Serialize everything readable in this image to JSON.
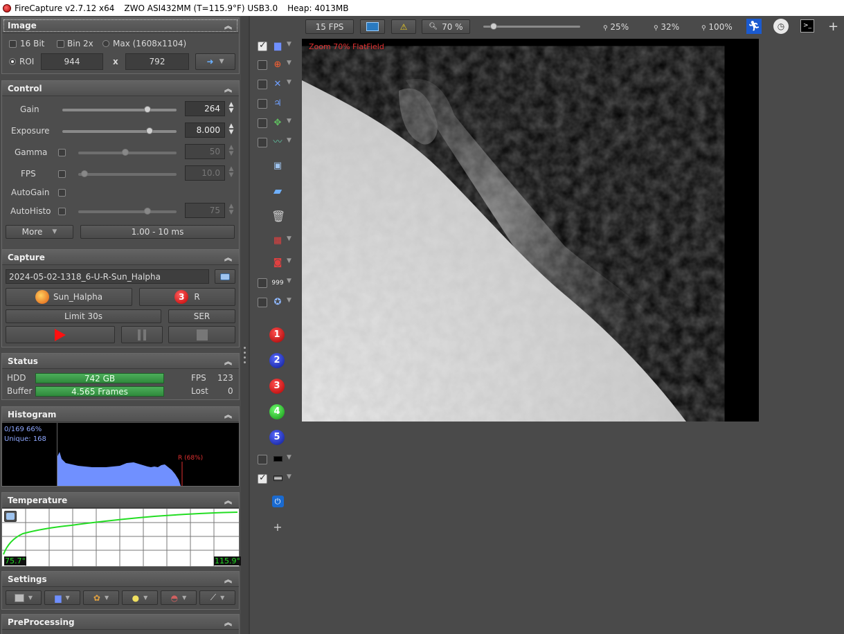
{
  "titlebar": {
    "app": "FireCapture v2.7.12 x64",
    "camera": "ZWO ASI432MM (T=115.9°F) USB3.0",
    "heap": "Heap: 4013MB"
  },
  "image_panel": {
    "title": "Image",
    "opt_16bit": "16 Bit",
    "opt_bin": "Bin 2x",
    "opt_max": "Max (1608x1104)",
    "opt_roi": "ROI",
    "roi_w": "944",
    "roi_x": "x",
    "roi_h": "792"
  },
  "control_panel": {
    "title": "Control",
    "gain_label": "Gain",
    "gain_value": "264",
    "exposure_label": "Exposure",
    "exposure_value": "8.000",
    "gamma_label": "Gamma",
    "gamma_value": "50",
    "fps_label": "FPS",
    "fps_value": "10.0",
    "autogain_label": "AutoGain",
    "autohisto_label": "AutoHisto",
    "autohisto_value": "75",
    "more_label": "More",
    "range_label": "1.00 - 10 ms"
  },
  "capture_panel": {
    "title": "Capture",
    "filename": "2024-05-02-1318_6-U-R-Sun_Halpha",
    "profile": "Sun_Halpha",
    "filter_number": "3",
    "filter": "R",
    "limit": "Limit 30s",
    "format": "SER"
  },
  "status_panel": {
    "title": "Status",
    "hdd_label": "HDD",
    "hdd_value": "742 GB",
    "buffer_label": "Buffer",
    "buffer_value": "4.565 Frames",
    "fps_label": "FPS",
    "fps_value": "123",
    "lost_label": "Lost",
    "lost_value": "0"
  },
  "histogram_panel": {
    "title": "Histogram",
    "stat1": "0/169 66%",
    "stat2": "Unique: 168",
    "marker": "R (68%)"
  },
  "temperature_panel": {
    "title": "Temperature",
    "min": "75.7°",
    "max": "115.9°"
  },
  "settings_panel": {
    "title": "Settings"
  },
  "preprocessing_panel": {
    "title": "PreProcessing"
  },
  "top_toolbar": {
    "fps_button": "15 FPS",
    "zoom_button": "70 %",
    "zoom_slider_fraction": 0.08,
    "z25": "25%",
    "z32": "32%",
    "z100": "100%"
  },
  "image_overlay": {
    "zoom": "Zoom 70%",
    "flat": "FlatField"
  },
  "filter_balls": [
    {
      "n": "1",
      "color": "#c0161a"
    },
    {
      "n": "2",
      "color": "#1a2fb8"
    },
    {
      "n": "3",
      "color": "#d8161a"
    },
    {
      "n": "4",
      "color": "#1db81d"
    },
    {
      "n": "5",
      "color": "#1a2fb8"
    }
  ],
  "colors": {
    "accent_red": "#e03030",
    "status_green": "#3a9c48",
    "histogram_blue": "#6f8fff",
    "temperature_green": "#22dd22"
  }
}
